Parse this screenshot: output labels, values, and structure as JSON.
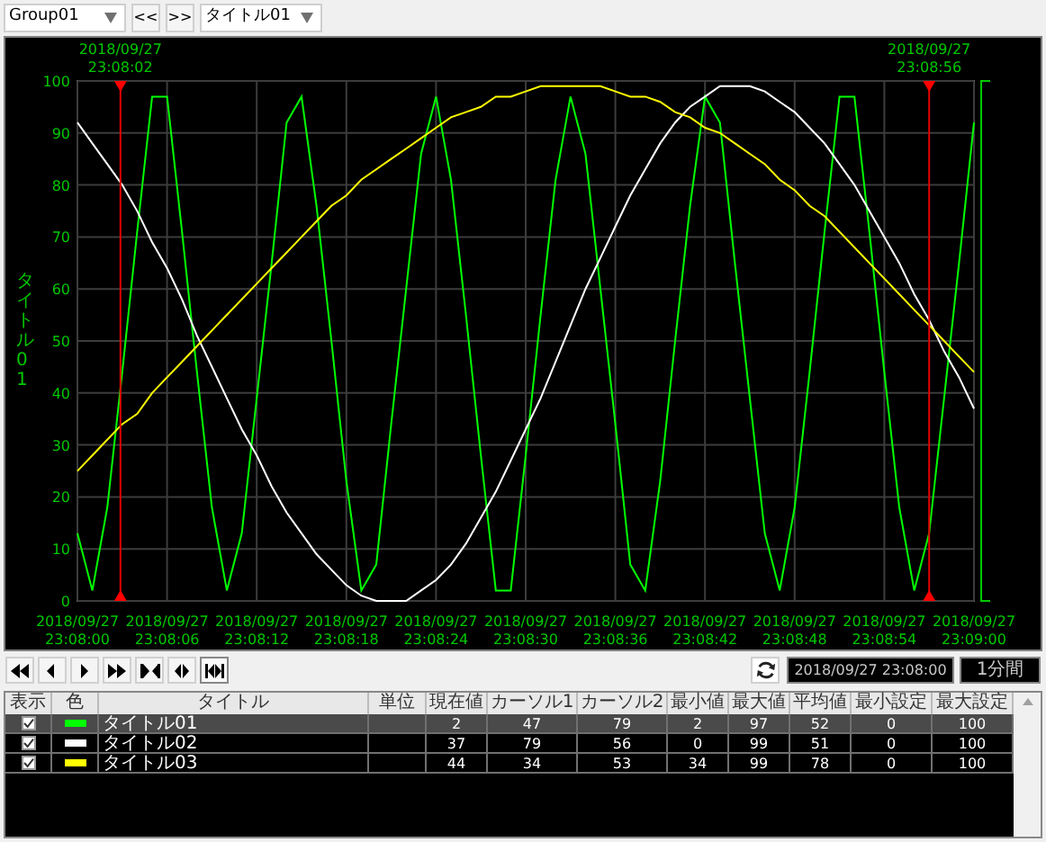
{
  "toolbar": {
    "group_select": {
      "value": "Group01"
    },
    "prev_button": "<<",
    "next_button": ">>",
    "title_select": {
      "value": "タイトル01"
    }
  },
  "chart": {
    "chart_data": {
      "type": "line",
      "ylabel": "タイトル01",
      "ylim": [
        0,
        100
      ],
      "categories": [
        "2018/09/27 23:08:00",
        null,
        null,
        null,
        null,
        null,
        "2018/09/27 23:08:06",
        null,
        null,
        null,
        null,
        null,
        "2018/09/27 23:08:12",
        null,
        null,
        null,
        null,
        null,
        "2018/09/27 23:08:18",
        null,
        null,
        null,
        null,
        null,
        "2018/09/27 23:08:24",
        null,
        null,
        null,
        null,
        null,
        "2018/09/27 23:08:30",
        null,
        null,
        null,
        null,
        null,
        "2018/09/27 23:08:36",
        null,
        null,
        null,
        null,
        null,
        "2018/09/27 23:08:42",
        null,
        null,
        null,
        null,
        null,
        "2018/09/27 23:08:48",
        null,
        null,
        null,
        null,
        null,
        "2018/09/27 23:08:54",
        null,
        null,
        null,
        null,
        null,
        "2018/09/27 23:09:00"
      ],
      "yticks": [
        0,
        10,
        20,
        30,
        40,
        50,
        60,
        70,
        80,
        90,
        100
      ],
      "series": [
        {
          "color": "#00ff00",
          "values": [
            13,
            2,
            18,
            44,
            71,
            97,
            97,
            71,
            44,
            18,
            2,
            13,
            39,
            65,
            92,
            97,
            76,
            50,
            23,
            2,
            7,
            34,
            60,
            86,
            97,
            81,
            55,
            28,
            2,
            2,
            28,
            55,
            81,
            97,
            86,
            60,
            34,
            7,
            2,
            23,
            50,
            76,
            97,
            92,
            65,
            39,
            13,
            2,
            18,
            44,
            71,
            97,
            97,
            71,
            44,
            18,
            2,
            13,
            39,
            65,
            92
          ]
        },
        {
          "color": "#ffffff",
          "values": [
            92,
            88,
            84,
            80,
            75,
            69,
            64,
            58,
            51,
            45,
            39,
            33,
            28,
            22,
            17,
            13,
            9,
            6,
            3,
            1,
            0,
            0,
            0,
            2,
            4,
            7,
            11,
            16,
            21,
            27,
            33,
            39,
            46,
            53,
            60,
            66,
            72,
            78,
            83,
            88,
            92,
            95,
            97,
            99,
            99,
            99,
            98,
            96,
            94,
            91,
            88,
            84,
            80,
            75,
            70,
            65,
            59,
            54,
            48,
            43,
            37
          ]
        },
        {
          "color": "#ffff00",
          "values": [
            25,
            28,
            31,
            34,
            36,
            40,
            43,
            46,
            49,
            52,
            55,
            58,
            61,
            64,
            67,
            70,
            73,
            76,
            78,
            81,
            83,
            85,
            87,
            89,
            91,
            93,
            94,
            95,
            97,
            97,
            98,
            99,
            99,
            99,
            99,
            99,
            98,
            97,
            97,
            96,
            94,
            93,
            91,
            90,
            88,
            86,
            84,
            81,
            79,
            76,
            74,
            71,
            68,
            65,
            62,
            59,
            56,
            53,
            50,
            47,
            44
          ]
        }
      ],
      "grid": true
    },
    "cursors": [
      {
        "label": "2018/09/27 23:08:02",
        "level": 0.048
      },
      {
        "label": "2018/09/27 23:08:56",
        "level": 0.95
      }
    ]
  },
  "controls": {
    "nav_buttons": [
      {
        "kind": "first"
      },
      {
        "kind": "prev"
      },
      {
        "kind": "next"
      },
      {
        "kind": "last"
      },
      {
        "kind": "collapse"
      },
      {
        "kind": "expand"
      },
      {
        "kind": "fit"
      }
    ],
    "datetime": "2018/09/27 23:08:00",
    "span": "1分間"
  },
  "table": {
    "columns": [
      "表示",
      "色",
      "タイトル",
      "単位",
      "現在値",
      "カーソル1",
      "カーソル2",
      "最小値",
      "最大値",
      "平均値",
      "最小設定",
      "最大設定"
    ],
    "rows": [
      {
        "visible": true,
        "selected": true,
        "color": "#00ff00",
        "title": "タイトル01",
        "values": [
          "2",
          "47",
          "79",
          "2",
          "97",
          "52",
          "0",
          "100"
        ]
      },
      {
        "visible": true,
        "selected": false,
        "color": "#ffffff",
        "title": "タイトル02",
        "values": [
          "37",
          "79",
          "56",
          "0",
          "99",
          "51",
          "0",
          "100"
        ]
      },
      {
        "visible": true,
        "selected": false,
        "color": "#ffff00",
        "title": "タイトル03",
        "values": [
          "44",
          "34",
          "53",
          "34",
          "99",
          "78",
          "0",
          "100"
        ]
      }
    ]
  }
}
